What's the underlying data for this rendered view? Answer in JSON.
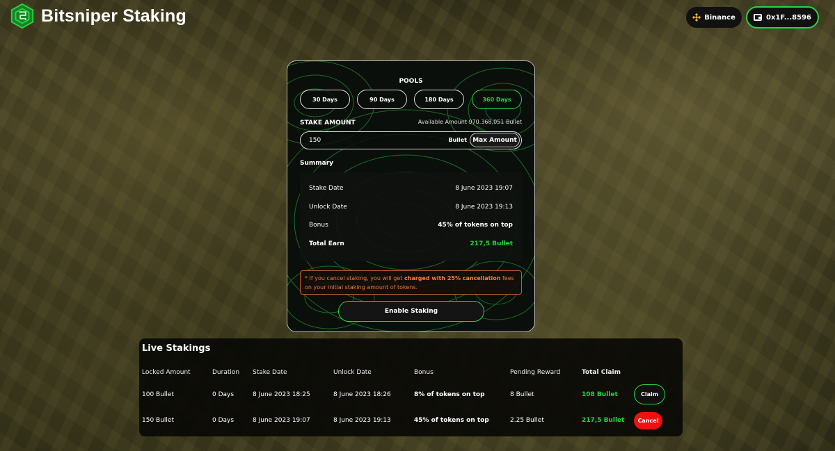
{
  "app": {
    "title": "Bitsniper Staking"
  },
  "header": {
    "network_label": "Binance",
    "wallet_label": "0x1F...8596"
  },
  "pools": {
    "title": "POOLS",
    "options": [
      "30 Days",
      "90 Days",
      "180 Days",
      "360 Days"
    ],
    "selected": "360 Days"
  },
  "stake": {
    "label": "STAKE AMOUNT",
    "available": "Available Amount 970.368,051 Bullet",
    "amount_value": "150",
    "unit": "Bullet",
    "max_label": "Max Amount"
  },
  "summary": {
    "title": "Summary",
    "rows": [
      {
        "key": "Stake Date",
        "value": "8 June 2023 19:07"
      },
      {
        "key": "Unlock Date",
        "value": "8 June 2023 19:13"
      },
      {
        "key": "Bonus",
        "value": "45% of tokens on top"
      },
      {
        "key": "Total Earn",
        "value": "217,5 Bullet"
      }
    ]
  },
  "warning": {
    "prefix": "* If you cancel staking, you will get ",
    "highlight": "charged with 25% cancellation",
    "suffix": " fees on your initial staking amount of tokens."
  },
  "enable_label": "Enable Staking",
  "live": {
    "title": "Live Stakings",
    "columns": [
      "Locked Amount",
      "Duration",
      "Stake Date",
      "Unlock Date",
      "Bonus",
      "Pending Reward",
      "Total Claim"
    ],
    "rows": [
      {
        "locked": "100 Bullet",
        "duration": "0 Days",
        "stake_date": "8 June 2023 18:25",
        "unlock_date": "8 June 2023 18:26",
        "bonus": "8% of tokens on top",
        "pending": "8 Bullet",
        "total": "108 Bullet",
        "action": "Claim"
      },
      {
        "locked": "150 Bullet",
        "duration": "0 Days",
        "stake_date": "8 June 2023 19:07",
        "unlock_date": "8 June 2023 19:13",
        "bonus": "45% of tokens on top",
        "pending": "2.25 Bullet",
        "total": "217,5 Bullet",
        "action": "Cancel"
      }
    ]
  },
  "colors": {
    "accent": "#22d83a",
    "danger": "#ee1111",
    "warning": "#e87a3c"
  },
  "icons": {
    "logo": "cube-logo-icon",
    "network": "binance-icon",
    "wallet": "wallet-icon"
  }
}
